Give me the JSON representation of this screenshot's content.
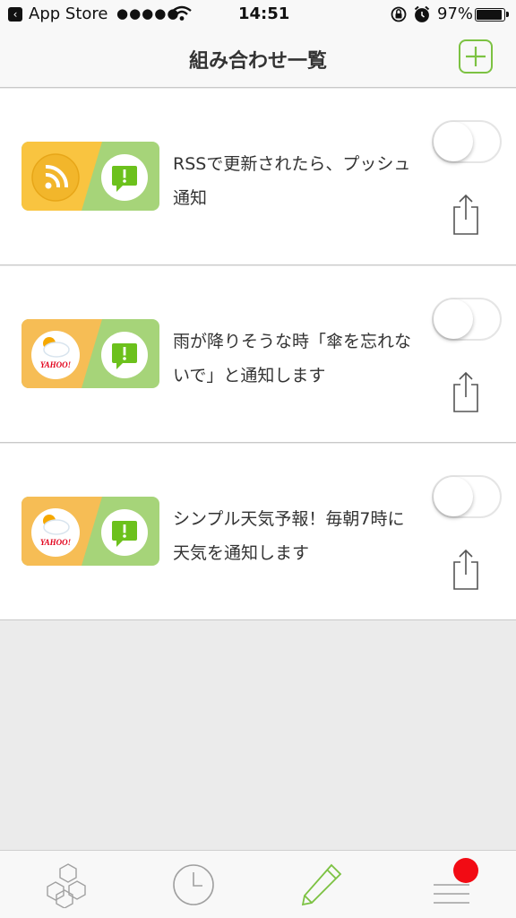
{
  "status_bar": {
    "back_app": "App Store",
    "signal": "●●●●●",
    "time": "14:51",
    "battery": "97%",
    "battery_level": 0.97
  },
  "nav": {
    "title": "組み合わせ一覧",
    "add_icon": "plus-icon"
  },
  "combinations": [
    {
      "text": "RSSで更新されたら、プッシュ通知",
      "left_icon": "rss-icon",
      "right_icon": "notification-icon",
      "left_color": "#f9c440",
      "right_color": "#a6d479",
      "enabled": false
    },
    {
      "text": "雨が降りそうな時「傘を忘れないで」と通知します",
      "left_icon": "yahoo-weather-icon",
      "right_icon": "notification-icon",
      "left_color": "#f6bd55",
      "right_color": "#a6d479",
      "enabled": false
    },
    {
      "text": "シンプル天気予報！毎朝7時に天気を通知します",
      "left_icon": "yahoo-weather-icon",
      "right_icon": "notification-icon",
      "left_color": "#f6bd55",
      "right_color": "#a6d479",
      "enabled": false
    }
  ],
  "yahoo_logo": "YAHOO!",
  "tabs": [
    {
      "icon": "hexagons-icon"
    },
    {
      "icon": "clock-icon"
    },
    {
      "icon": "pencil-icon",
      "active": true
    },
    {
      "icon": "menu-icon",
      "badge": true
    }
  ],
  "colors": {
    "accent": "#7cc242",
    "badge": "#f20b14",
    "background": "#ebebeb"
  }
}
